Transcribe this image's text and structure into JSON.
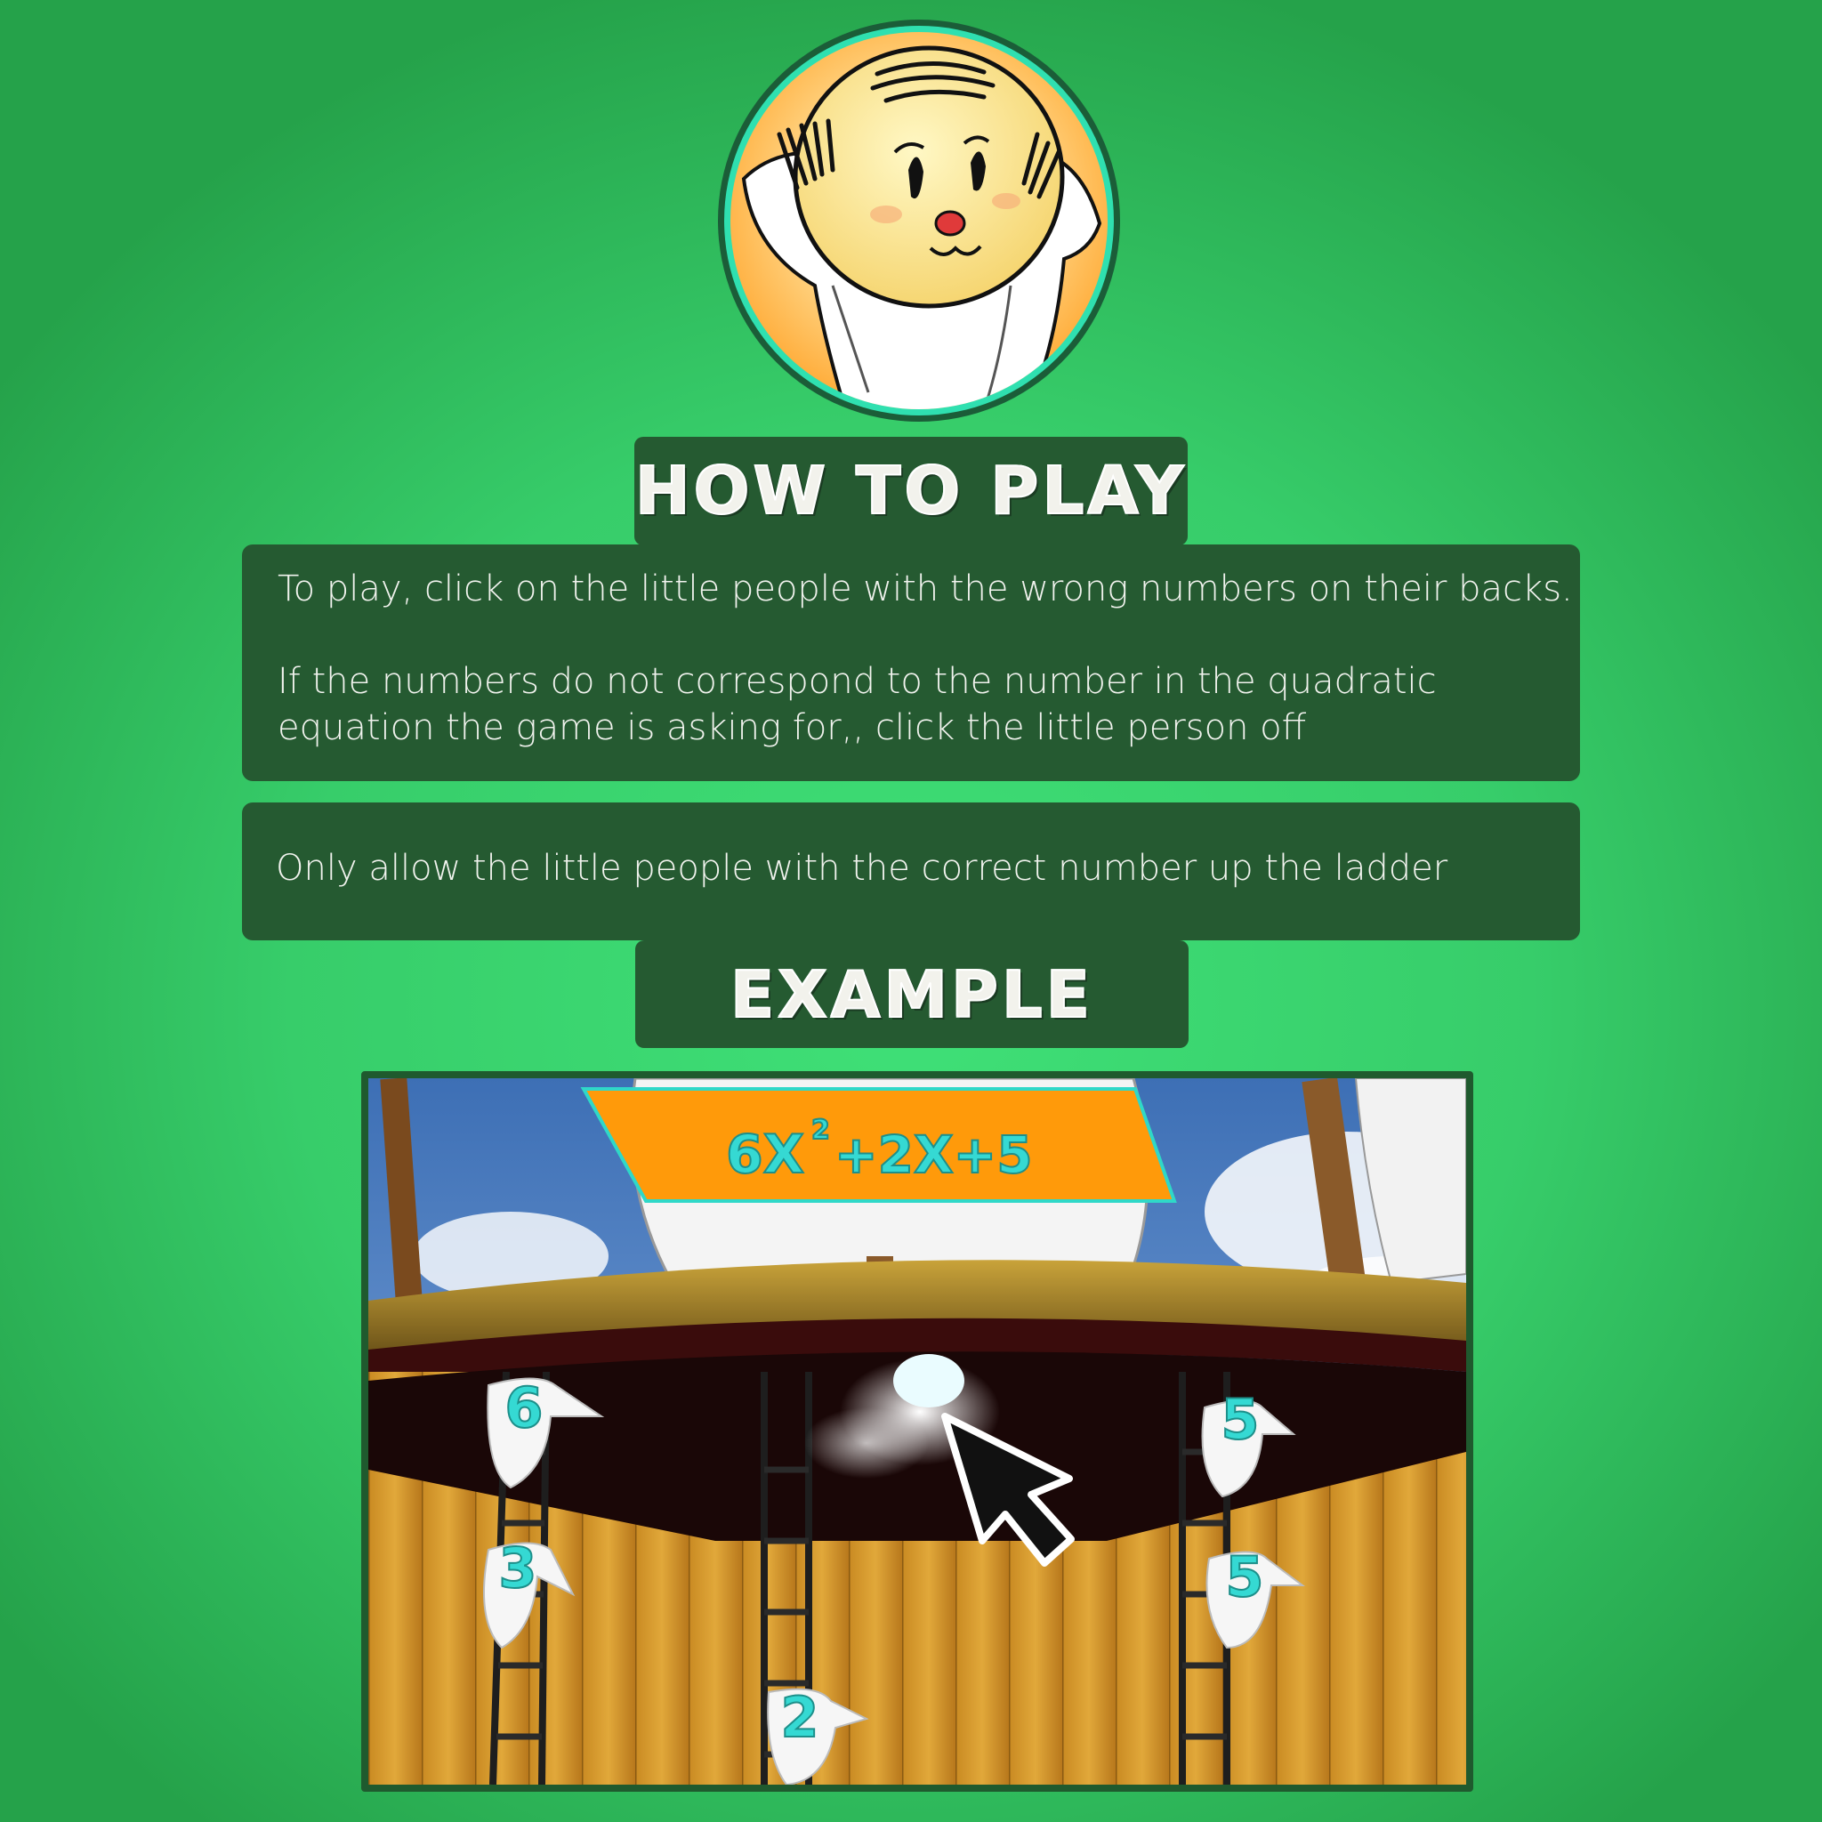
{
  "how_to_play": {
    "title": "HOW TO PLAY",
    "paragraph1": "To play, click on the little people with the wrong numbers on their backs.",
    "paragraph2": "If the numbers do not correspond to the number in the quadratic equation the game is asking for,, click the little person off",
    "note": "Only allow the little people with the correct number up the ladder"
  },
  "example": {
    "title": "EXAMPLE",
    "equation": {
      "coef_a": "6X",
      "exponent": "2",
      "rest": "+2X+5"
    },
    "people_numbers": {
      "left_top": "6",
      "left_bottom": "3",
      "center_bottom": "2",
      "right_top": "5",
      "right_bottom": "5"
    }
  },
  "colors": {
    "background": "#3fe077",
    "panel": "#255a31",
    "banner": "#ff9a0a",
    "number": "#35d9d3"
  }
}
